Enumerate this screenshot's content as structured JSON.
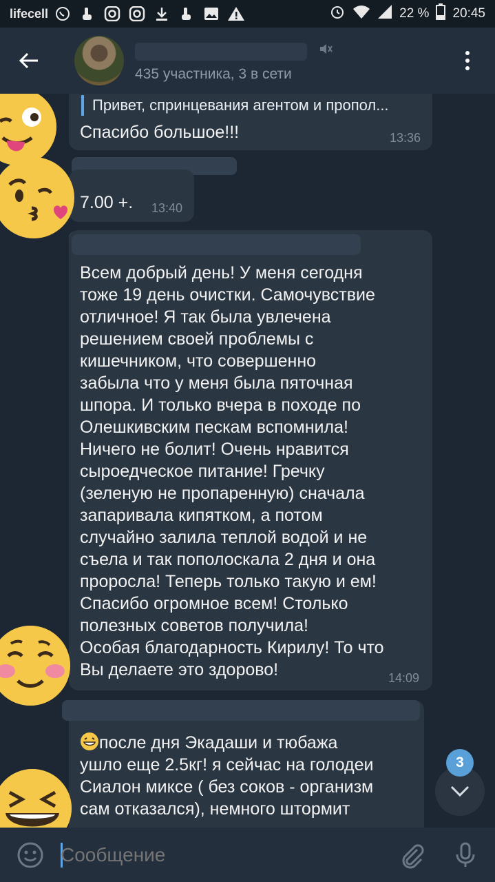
{
  "statusbar": {
    "carrier": "lifecell",
    "battery": "22 %",
    "time": "20:45"
  },
  "header": {
    "subtitle": "435 участника, 3 в сети"
  },
  "messages": [
    {
      "reply": "Привет, спринцевания агентом и пропол...",
      "text": "Спасибо большое!!!",
      "time": "13:36"
    },
    {
      "text": "7.00 +.",
      "time": "13:40"
    },
    {
      "lines": [
        "Всем добрый день! У меня сегодня",
        "тоже 19 день очистки. Самочувствие",
        "отличное! Я так была увлечена",
        "решением своей проблемы с",
        "кишечником, что совершенно",
        "забыла что у меня была пяточная",
        "шпора. И только вчера в походе по",
        "Олешкивским пескам вспомнила!",
        "Ничего не болит! Очень нравится",
        "сыроедческое питание! Гречку",
        "(зеленую не пропаренную) сначала",
        "запаривала  кипятком, а потом",
        "случайно залила теплой водой и не",
        "съела и так пополоскала 2 дня и она",
        "проросла! Теперь только такую и ем!",
        "Спасибо огромное всем! Столько",
        "полезных советов получила!",
        "Особая благодарность Кирилу! То что",
        "Вы делаете это здорово!"
      ],
      "time": "14:09"
    },
    {
      "lines": [
        "после дня Экадаши и тюбажа",
        "ушло еще 2.5кг! я сейчас на голодеи",
        "Сиалон миксе ( без соков - организм",
        "сам отказался), немного штормит"
      ]
    }
  ],
  "scroll": {
    "unread": "3"
  },
  "input": {
    "placeholder": "Сообщение"
  }
}
